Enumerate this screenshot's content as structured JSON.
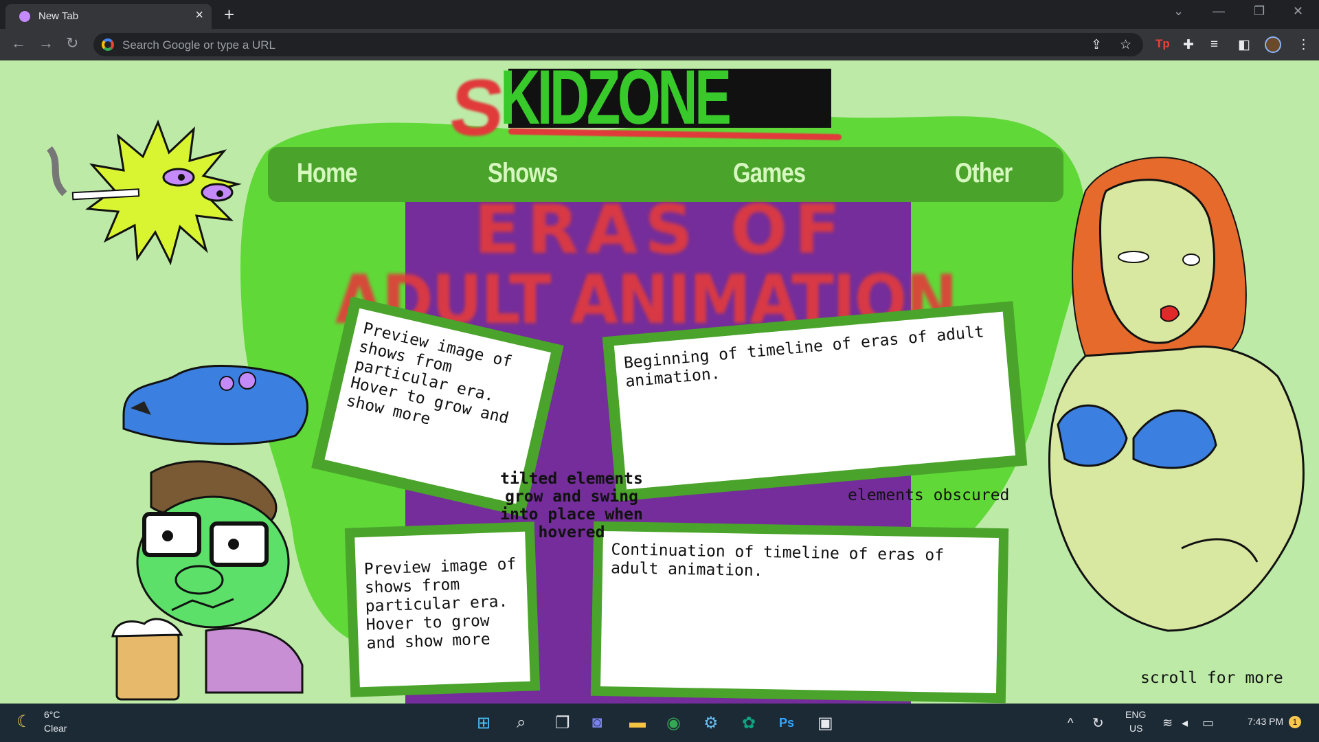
{
  "browser": {
    "tab_title": "New Tab",
    "omnibox_placeholder": "Search Google or type a URL"
  },
  "site": {
    "logo_s": "S",
    "logo_text": "KIDZONE",
    "heading_line1": "ERAS OF",
    "heading_line2": "ADULT ANIMATION",
    "nav": [
      "Home",
      "Shows",
      "Games",
      "Other"
    ],
    "cards": [
      {
        "text": "Preview image of shows from particular era. Hover to grow and show more"
      },
      {
        "text": "Beginning of timeline of eras of adult animation."
      },
      {
        "text": "Preview image of shows from particular era. Hover to grow and show more"
      },
      {
        "text": "Continuation of timeline of eras of adult animation."
      }
    ],
    "note_tilted": "tilted elements grow and swing into place when hovered",
    "note_obscured": "elements obscured",
    "note_scroll": "scroll for more"
  },
  "taskbar": {
    "temperature": "6°C",
    "weather": "Clear",
    "lang1": "ENG",
    "lang2": "US",
    "time": "7:43 PM",
    "notification_count": "1"
  },
  "colors": {
    "page_bg": "#bdeaa7",
    "nav_green": "#4aa32a",
    "blob_green": "#5fd838",
    "purple": "#742d9a",
    "heading_red": "#e33b3b"
  }
}
